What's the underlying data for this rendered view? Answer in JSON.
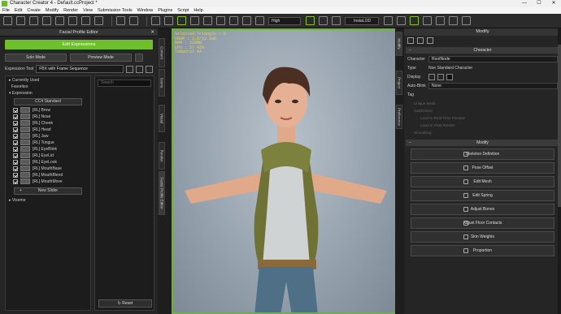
{
  "window": {
    "title": "Character Creator 4 - Default.ccProject *",
    "controls": [
      "—",
      "☐",
      "✕"
    ]
  },
  "menu": [
    "File",
    "Edit",
    "Create",
    "Modify",
    "Render",
    "View",
    "Submission Tools",
    "Window",
    "Plugins",
    "Script",
    "Help"
  ],
  "toolbar": {
    "quality": "High",
    "lod": "InstaLOD"
  },
  "facial_editor": {
    "title": "Facial Profile Editor",
    "edit_button": "Edit Expressions",
    "solo_mode": "Solo Mode",
    "preview_mode": "Preview Mode",
    "expression_tool_label": "Expression Tool",
    "expression_tool_value": "FBX with Frame Sequence",
    "tree_currently_used": "Currently Used",
    "tree_favorites": "Favorites",
    "tree_expression": "Expression",
    "cc4_standard": "CC4 Standard",
    "items": [
      "[RL] Brow",
      "[RL] Nose",
      "[RL] Cheek",
      "[RL] Head",
      "[RL] Jaw",
      "[RL] Tongue",
      "[RL] EyeBlink",
      "[RL] EyeLid",
      "[RL] EyeLook",
      "[RL] MouthBase",
      "[RL] MouthBlend",
      "[RL] MouthMove"
    ],
    "new_slider": "New Slider",
    "viseme": "Viseme",
    "search_placeholder": "Search",
    "reset": "Reset"
  },
  "vtabs": [
    "Content",
    "Scene",
    "Visual",
    "Render",
    "Facial Profile Editor"
  ],
  "right_vtabs": [
    "Modify",
    "Project",
    "Preference"
  ],
  "stats": [
    "Selected Triangle : 0",
    "VRAM : 3.6/12.1GB",
    "RAM : 220MB",
    "CPU : 27.42%",
    "Temporal AA"
  ],
  "modify": {
    "title": "Modify",
    "section_character": "Character",
    "character_label": "Character",
    "character_value": "RootNode",
    "type_label": "Type",
    "type_value": "Non Standard Character",
    "display_label": "Display",
    "autoblink_label": "Auto-Blink",
    "autoblink_value": "None",
    "tag_label": "Tag",
    "dim_rows": [
      "Unique Mesh",
      "Subdivision",
      "Level in Real-Time Preview",
      "Level in Final Render",
      "Smoothing"
    ],
    "section_modify": "Modify",
    "buttons": [
      "Skeleton Definition",
      "Pose Offset",
      "Edit Mesh",
      "Edit Spring",
      "Adjust Bones",
      "Adjust Floor Contacts",
      "Skin Weights",
      "Proportion"
    ]
  }
}
